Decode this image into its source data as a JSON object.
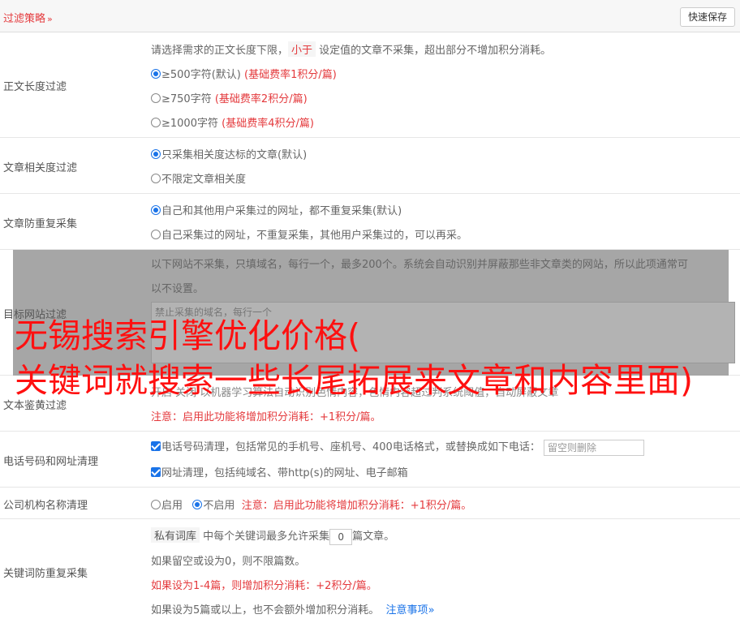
{
  "header": {
    "title": "过滤策略",
    "chevron": "»",
    "save_label": "快速保存"
  },
  "length_filter": {
    "label": "正文长度过滤",
    "desc_before": "请选择需求的正文长度下限，",
    "desc_tag": "小于",
    "desc_after": "设定值的文章不采集，超出部分不增加积分消耗。",
    "options": [
      {
        "text": "≥500字符(默认)",
        "note": "(基础费率1积分/篇)",
        "selected": true
      },
      {
        "text": "≥750字符",
        "note": "(基础费率2积分/篇)",
        "selected": false
      },
      {
        "text": "≥1000字符",
        "note": "(基础费率4积分/篇)",
        "selected": false
      }
    ]
  },
  "relevance_filter": {
    "label": "文章相关度过滤",
    "options": [
      {
        "text": "只采集相关度达标的文章(默认)",
        "selected": true
      },
      {
        "text": "不限定文章相关度",
        "selected": false
      }
    ]
  },
  "dedupe_filter": {
    "label": "文章防重复采集",
    "options": [
      {
        "text": "自己和其他用户采集过的网址，都不重复采集(默认)",
        "selected": true
      },
      {
        "text": "自己采集过的网址，不重复采集，其他用户采集过的，可以再采。",
        "selected": false
      }
    ]
  },
  "site_filter": {
    "label": "目标网站过滤",
    "desc_line1": "以下网站不采集，只填域名，每行一个，最多200个。系统会自动识别并屏蔽那些非文章类的网站，所以此项通常可",
    "desc_line2": "以不设置。",
    "placeholder": "禁止采集的域名，每行一个"
  },
  "porn_filter": {
    "label": "文本鉴黄过滤",
    "line1": "开启   关闭  以机器学习算法自动识别色情内容，色情内容超过判系统阈值，自动屏蔽文章",
    "note": "注意：启用此功能将增加积分消耗：+1积分/篇。"
  },
  "phone_clean": {
    "label": "电话号码和网址清理",
    "phone_text": "电话号码清理，包括常见的手机号、座机号、400电话格式，或替换成如下电话：",
    "phone_placeholder": "留空则删除",
    "url_text": "网址清理，包括纯域名、带http(s)的网址、电子邮箱"
  },
  "company_clean": {
    "label": "公司机构名称清理",
    "enable": "启用",
    "disable": "不启用",
    "note": "注意：启用此功能将增加积分消耗：+1积分/篇。"
  },
  "keyword_dedupe": {
    "label": "关键词防重复采集",
    "tag": "私有词库",
    "text1": "中每个关键词最多允许采集",
    "value": "0",
    "text2": "篇文章。",
    "line2": "如果留空或设为0，则不限篇数。",
    "line3": "如果设为1-4篇，则增加积分消耗：+2积分/篇。",
    "line4": "如果设为5篇或以上，也不会额外增加积分消耗。",
    "link": "注意事项",
    "link_chevron": "»"
  },
  "watermark": {
    "line1": "无锡搜索引擎优化价格(",
    "line2": "关键词就搜索一些长尾拓展来文章和内容里面)"
  }
}
